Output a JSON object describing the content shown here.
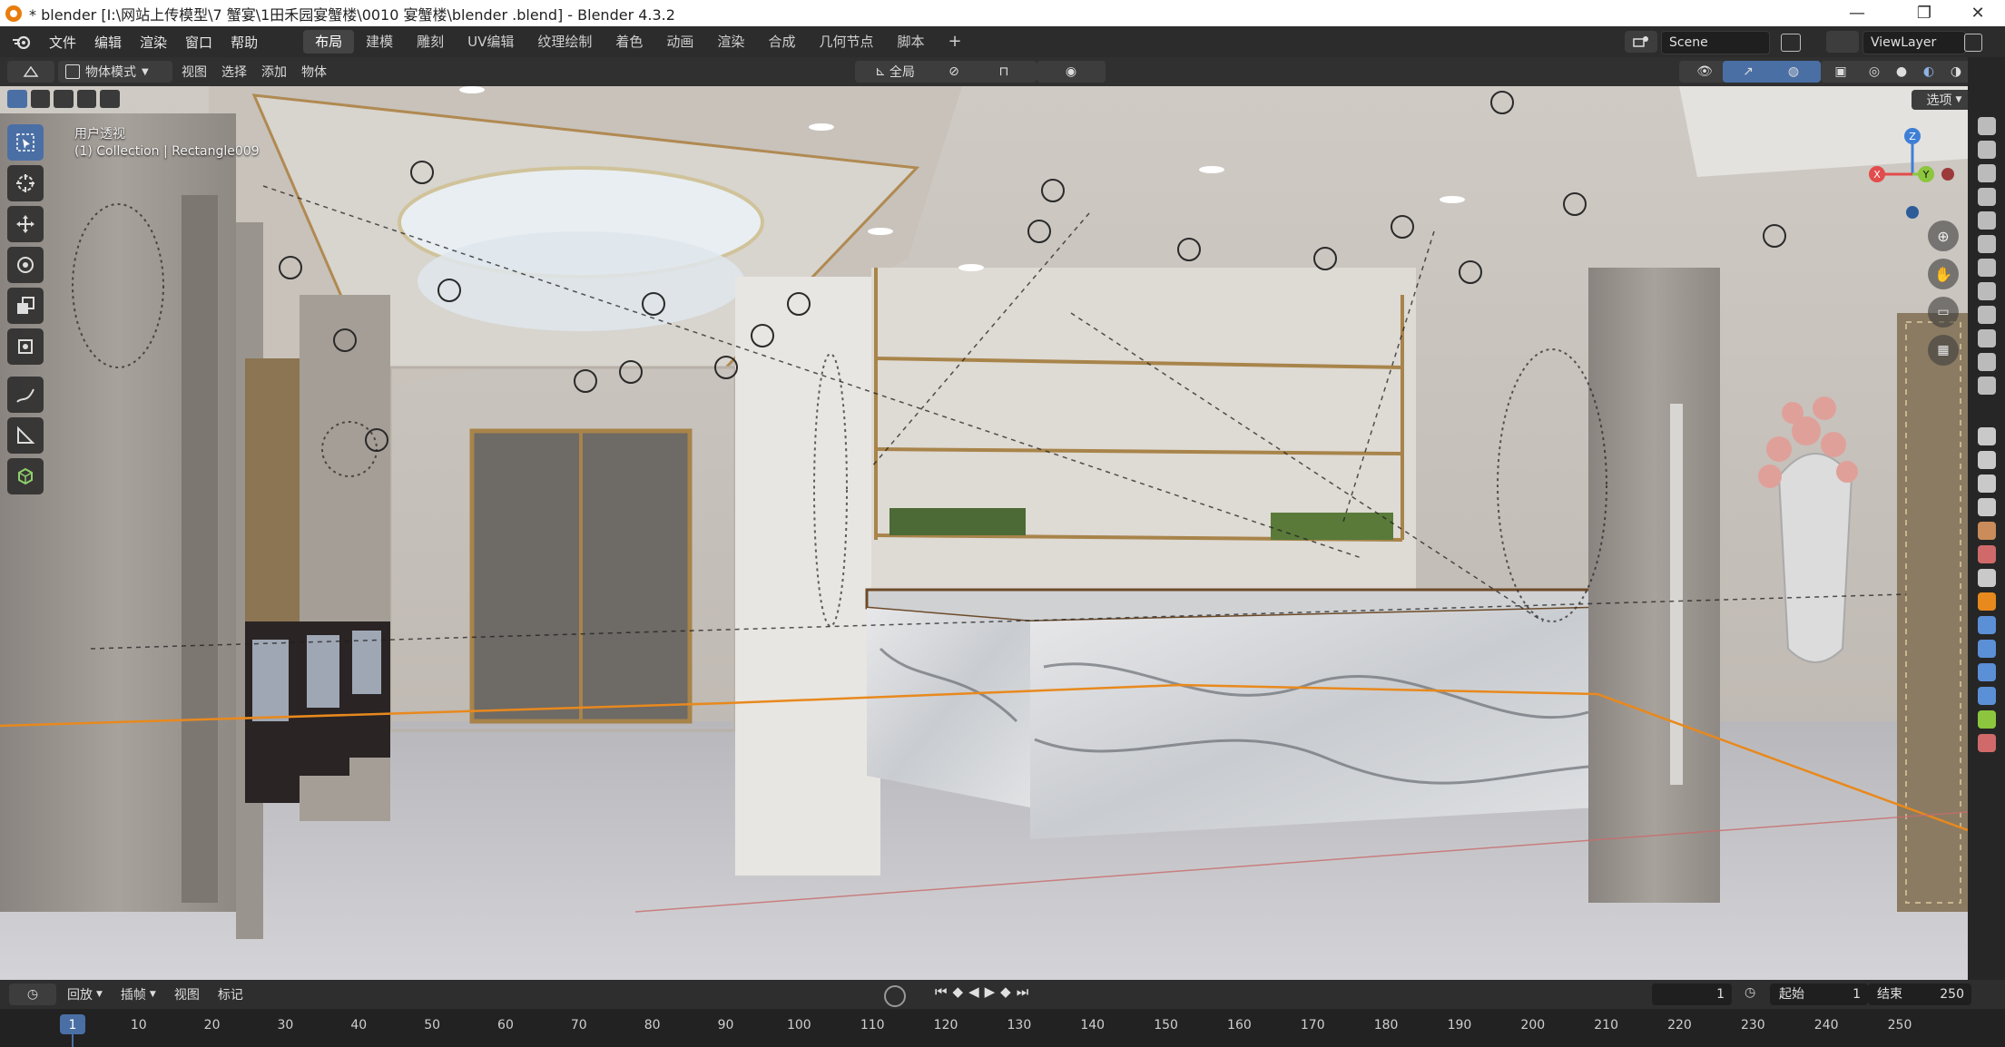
{
  "window": {
    "title": "* blender  [I:\\网站上传模型\\7 蟹宴\\1田禾园宴蟹楼\\0010 宴蟹楼\\blender .blend] - Blender 4.3.2",
    "controls": [
      "—",
      "❐",
      "✕"
    ]
  },
  "menubar": {
    "menus": [
      "文件",
      "编辑",
      "渲染",
      "窗口",
      "帮助"
    ],
    "workspaces": [
      "布局",
      "建模",
      "雕刻",
      "UV编辑",
      "纹理绘制",
      "着色",
      "动画",
      "渲染",
      "合成",
      "几何节点",
      "脚本"
    ],
    "active_workspace": "布局",
    "add_tab": "+",
    "scene": "Scene",
    "view_layer": "ViewLayer"
  },
  "header": {
    "mode": "物体模式",
    "items": [
      "视图",
      "选择",
      "添加",
      "物体"
    ],
    "transform_orientation": "全局",
    "options": "选项"
  },
  "viewport": {
    "view_name": "用户透视",
    "collection": "(1) Collection | Rectangle009",
    "gizmo": {
      "x": "X",
      "y": "Y",
      "z": "Z"
    }
  },
  "toolbar": {
    "tools": [
      "select-box-icon",
      "cursor-icon",
      "move-icon",
      "rotate-icon",
      "scale-icon",
      "transform-icon",
      "annotate-icon",
      "measure-icon",
      "add-cube-icon"
    ]
  },
  "timeline": {
    "menus": [
      "回放",
      "插帧",
      "视图",
      "标记"
    ],
    "current_frame": "1",
    "start_label": "起始",
    "start_value": "1",
    "end_label": "结束",
    "end_value": "250",
    "ruler_ticks": [
      "1",
      "10",
      "20",
      "30",
      "40",
      "50",
      "60",
      "70",
      "80",
      "90",
      "100",
      "110",
      "120",
      "130",
      "140",
      "150",
      "160",
      "170",
      "180",
      "190",
      "200",
      "210",
      "220",
      "230",
      "240",
      "250"
    ]
  },
  "colors": {
    "accent": "#4a6fa5",
    "selection_outline": "#e8891d",
    "x_axis": "#e24c4c",
    "y_axis": "#8cc63e",
    "z_axis": "#3e7fd6"
  }
}
